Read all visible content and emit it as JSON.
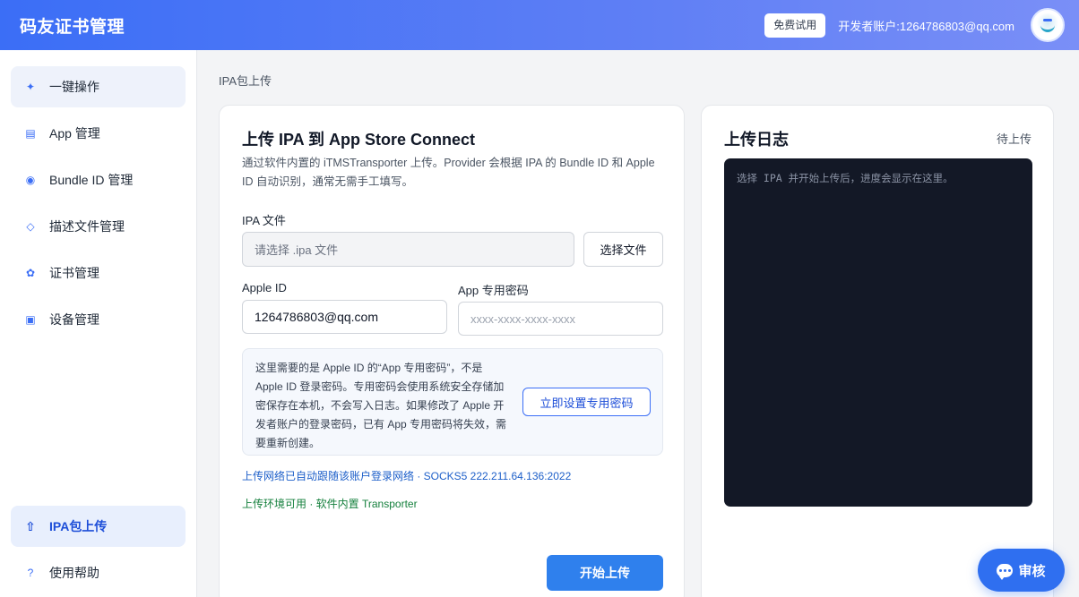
{
  "header": {
    "title": "码友证书管理",
    "trial_label": "免费试用",
    "account": "开发者账户:1264786803@qq.com"
  },
  "sidebar": {
    "items": [
      {
        "label": "一键操作",
        "icon": "sparkle-icon",
        "glyph": "✦"
      },
      {
        "label": "App 管理",
        "icon": "list-icon",
        "glyph": "▤"
      },
      {
        "label": "Bundle ID 管理",
        "icon": "target-icon",
        "glyph": "◉"
      },
      {
        "label": "描述文件管理",
        "icon": "diamond-icon",
        "glyph": "◇"
      },
      {
        "label": "证书管理",
        "icon": "badge-icon",
        "glyph": "✿"
      },
      {
        "label": "设备管理",
        "icon": "device-icon",
        "glyph": "▣"
      }
    ],
    "bottom_items": [
      {
        "label": "IPA包上传",
        "icon": "upload-arrow-icon",
        "glyph": "⇧"
      },
      {
        "label": "使用帮助",
        "icon": "help-icon",
        "glyph": "?"
      }
    ]
  },
  "breadcrumb": "IPA包上传",
  "upload": {
    "title": "上传 IPA 到 App Store Connect",
    "description": "通过软件内置的 iTMSTransporter 上传。Provider 会根据 IPA 的 Bundle ID 和 Apple ID 自动识别，通常无需手工填写。",
    "ipa_label": "IPA 文件",
    "ipa_placeholder": "请选择 .ipa 文件",
    "choose_file_label": "选择文件",
    "apple_id_label": "Apple ID",
    "apple_id_value": "1264786803@qq.com",
    "app_password_label": "App 专用密码",
    "app_password_placeholder": "xxxx-xxxx-xxxx-xxxx",
    "notice": "这里需要的是 Apple ID 的“App 专用密码”，不是 Apple ID 登录密码。专用密码会使用系统安全存储加密保存在本机，不会写入日志。如果修改了 Apple 开发者账户的登录密码，已有 App 专用密码将失效，需要重新创建。",
    "setup_label": "立即设置专用密码",
    "network_info": "上传网络已自动跟随该账户登录网络 · SOCKS5 222.211.64.136:2022",
    "env_info": "上传环境可用 · 软件内置 Transporter",
    "start_label": "开始上传"
  },
  "log": {
    "title": "上传日志",
    "status": "待上传",
    "placeholder": "选择 IPA 并开始上传后，进度会显示在这里。"
  },
  "review_label": "审核",
  "colors": {
    "accent": "#3b6ef6",
    "primary_button": "#2f80ed",
    "console_bg": "#131826",
    "success": "#15803d"
  }
}
